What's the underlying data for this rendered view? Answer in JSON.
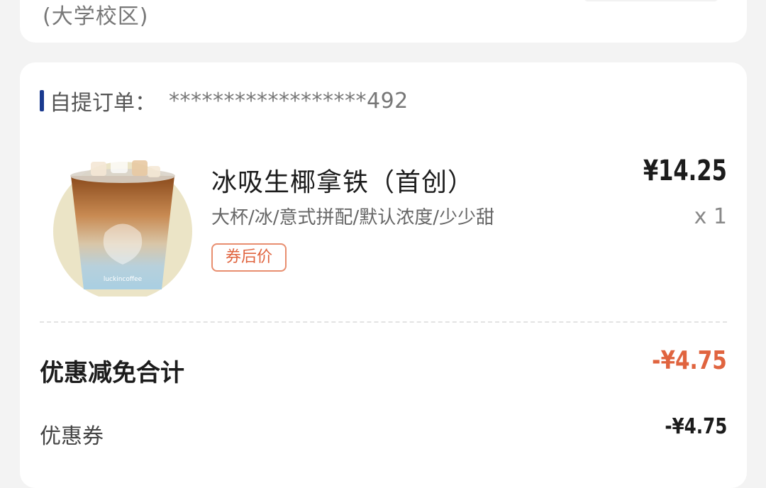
{
  "top_card": {
    "campus": "(大学校区)"
  },
  "order": {
    "label": "自提订单：",
    "number": "******************492"
  },
  "product": {
    "name": "冰吸生椰拿铁（首创）",
    "spec": "大杯/冰/意式拼配/默认浓度/少少甜",
    "tag": "券后价",
    "price": "¥14.25",
    "quantity": "x 1",
    "image": "iced-coconut-latte-cup"
  },
  "discount": {
    "total_label": "优惠减免合计",
    "total_value": "-¥4.75",
    "coupon_label": "优惠券",
    "coupon_value": "-¥4.75"
  },
  "colors": {
    "accent_red": "#e0643f",
    "brand_blue": "#1a3a8f"
  }
}
